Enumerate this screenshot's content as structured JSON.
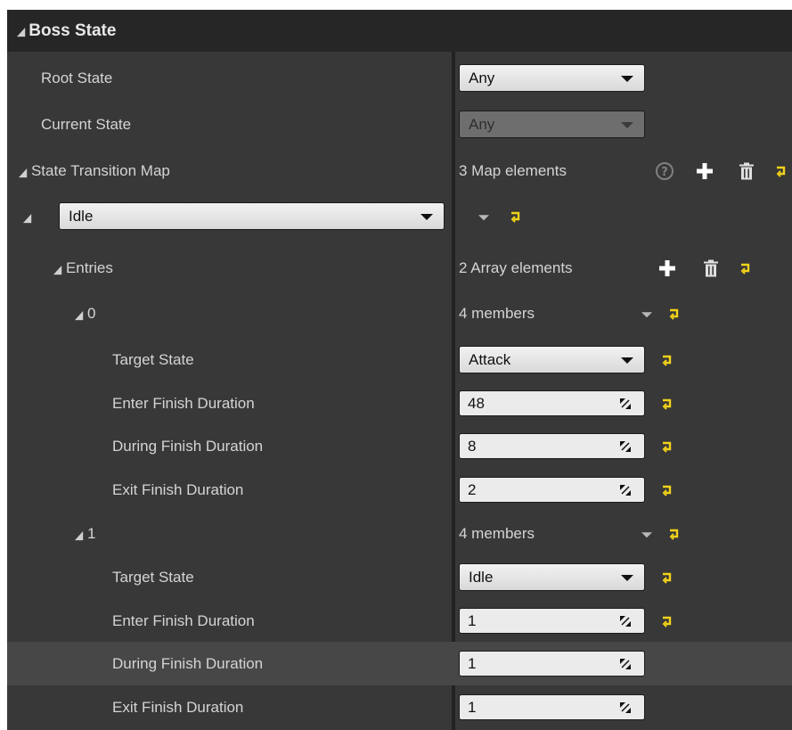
{
  "section": {
    "title": "Boss State"
  },
  "root_state": {
    "label": "Root State",
    "value": "Any"
  },
  "current_state": {
    "label": "Current State",
    "value": "Any"
  },
  "transition_map": {
    "label": "State Transition Map",
    "count": "3 Map elements"
  },
  "map_key": {
    "value": "Idle"
  },
  "entries": {
    "label": "Entries",
    "count": "2 Array elements"
  },
  "items": [
    {
      "index": "0",
      "members": "4 members",
      "target_state_label": "Target State",
      "target_state": "Attack",
      "enter_label": "Enter Finish Duration",
      "enter_value": "48",
      "during_label": "During Finish Duration",
      "during_value": "8",
      "exit_label": "Exit Finish Duration",
      "exit_value": "2"
    },
    {
      "index": "1",
      "members": "4 members",
      "target_state_label": "Target State",
      "target_state": "Idle",
      "enter_label": "Enter Finish Duration",
      "enter_value": "1",
      "during_label": "During Finish Duration",
      "during_value": "1",
      "exit_label": "Exit Finish Duration",
      "exit_value": "1"
    }
  ],
  "colors": {
    "panel_bg": "#383838",
    "header_bg": "#262626",
    "highlight_row": "#474747",
    "reset_icon": "#f2d21a",
    "help_icon": "#808080"
  },
  "icons": {
    "collapse": "triangle-icon",
    "reset": "reset-to-default-icon",
    "add": "plus-icon",
    "remove": "trash-icon",
    "help": "question-icon",
    "resize": "resize-handle-icon"
  }
}
